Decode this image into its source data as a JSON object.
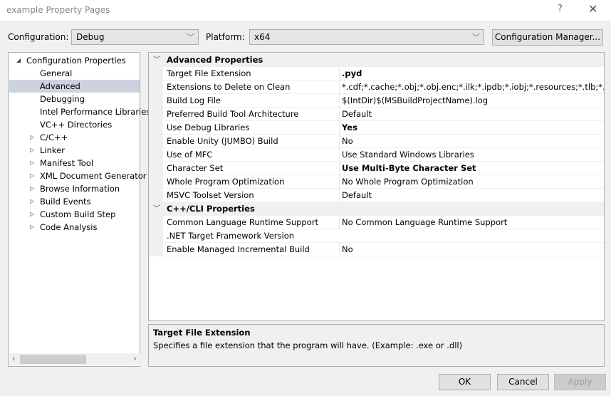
{
  "window": {
    "title": "example Property Pages",
    "help": "?",
    "close": "✕"
  },
  "config": {
    "configuration_label": "Configuration:",
    "configuration_value": "Debug",
    "platform_label": "Platform:",
    "platform_value": "x64",
    "manager_button": "Configuration Manager..."
  },
  "tree": {
    "items": [
      {
        "label": "Configuration Properties",
        "level": 0,
        "expander": "◢"
      },
      {
        "label": "General",
        "level": 1
      },
      {
        "label": "Advanced",
        "level": 1,
        "selected": true
      },
      {
        "label": "Debugging",
        "level": 1
      },
      {
        "label": "Intel Performance Libraries",
        "level": 1
      },
      {
        "label": "VC++ Directories",
        "level": 1
      },
      {
        "label": "C/C++",
        "level": 1,
        "expander": "▷"
      },
      {
        "label": "Linker",
        "level": 1,
        "expander": "▷"
      },
      {
        "label": "Manifest Tool",
        "level": 1,
        "expander": "▷"
      },
      {
        "label": "XML Document Generator",
        "level": 1,
        "expander": "▷"
      },
      {
        "label": "Browse Information",
        "level": 1,
        "expander": "▷"
      },
      {
        "label": "Build Events",
        "level": 1,
        "expander": "▷"
      },
      {
        "label": "Custom Build Step",
        "level": 1,
        "expander": "▷"
      },
      {
        "label": "Code Analysis",
        "level": 1,
        "expander": "▷"
      }
    ],
    "scroll_left": "‹",
    "scroll_right": "›"
  },
  "grid": {
    "rows": [
      {
        "category": "Advanced Properties"
      },
      {
        "name": "Target File Extension",
        "value": ".pyd",
        "bold": true
      },
      {
        "name": "Extensions to Delete on Clean",
        "value": "*.cdf;*.cache;*.obj;*.obj.enc;*.ilk;*.ipdb;*.iobj;*.resources;*.tlb;*.tli;*.tlh;"
      },
      {
        "name": "Build Log File",
        "value": "$(IntDir)$(MSBuildProjectName).log"
      },
      {
        "name": "Preferred Build Tool Architecture",
        "value": "Default"
      },
      {
        "name": "Use Debug Libraries",
        "value": "Yes",
        "bold": true
      },
      {
        "name": "Enable Unity (JUMBO) Build",
        "value": "No"
      },
      {
        "name": "Use of MFC",
        "value": "Use Standard Windows Libraries"
      },
      {
        "name": "Character Set",
        "value": "Use Multi-Byte Character Set",
        "bold": true
      },
      {
        "name": "Whole Program Optimization",
        "value": "No Whole Program Optimization"
      },
      {
        "name": "MSVC Toolset Version",
        "value": "Default"
      },
      {
        "category": "C++/CLI Properties"
      },
      {
        "name": "Common Language Runtime Support",
        "value": "No Common Language Runtime Support"
      },
      {
        "name": ".NET Target Framework Version",
        "value": ""
      },
      {
        "name": "Enable Managed Incremental Build",
        "value": "No"
      }
    ]
  },
  "description": {
    "title": "Target File Extension",
    "text": "Specifies a file extension that the program will have. (Example: .exe or .dll)"
  },
  "buttons": {
    "ok": "OK",
    "cancel": "Cancel",
    "apply": "Apply"
  }
}
